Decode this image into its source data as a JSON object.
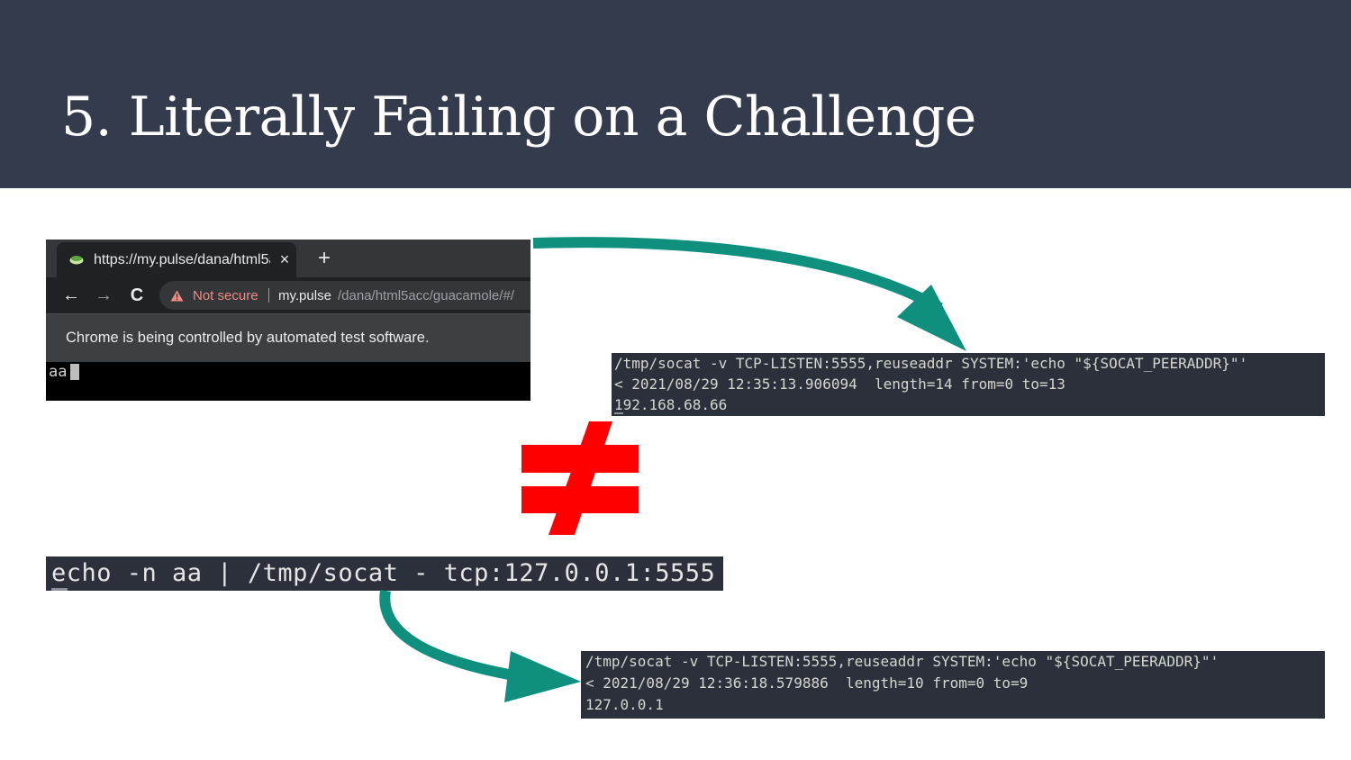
{
  "slide": {
    "title": "5. Literally Failing on a Challenge"
  },
  "browser": {
    "tab_title": "https://my.pulse/dana/html5acc/guacamole/#/",
    "tab_close": "×",
    "new_tab": "+",
    "nav": {
      "back": "←",
      "forward": "→",
      "reload": "C"
    },
    "omnibox": {
      "security_label": "Not secure",
      "url_host": "my.pulse",
      "url_path": "/dana/html5acc/guacamole/#/"
    },
    "infobar_text": "Chrome is being controlled by automated test software.",
    "page_text": "aa"
  },
  "terminal_top": {
    "lines": [
      "/tmp/socat -v TCP-LISTEN:5555,reuseaddr SYSTEM:'echo \"${SOCAT_PEERADDR}\"'",
      "< 2021/08/29 12:35:13.906094  length=14 from=0 to=13",
      "192.168.68.66"
    ]
  },
  "command": {
    "text": "echo -n aa | /tmp/socat - tcp:127.0.0.1:5555"
  },
  "terminal_bottom": {
    "lines": [
      "/tmp/socat -v TCP-LISTEN:5555,reuseaddr SYSTEM:'echo \"${SOCAT_PEERADDR}\"'",
      "< 2021/08/29 12:36:18.579886  length=10 from=0 to=9",
      "127.0.0.1"
    ]
  },
  "colors": {
    "header_bg": "#333b4d",
    "arrow": "#0f8f7e",
    "not_equal": "#ff0000",
    "terminal_bg": "#2b303b"
  },
  "icons": [
    "favicon-icon",
    "close-icon",
    "plus-icon",
    "back-arrow-icon",
    "forward-arrow-icon",
    "reload-icon",
    "warning-icon",
    "arrow-icon",
    "not-equal-icon"
  ]
}
